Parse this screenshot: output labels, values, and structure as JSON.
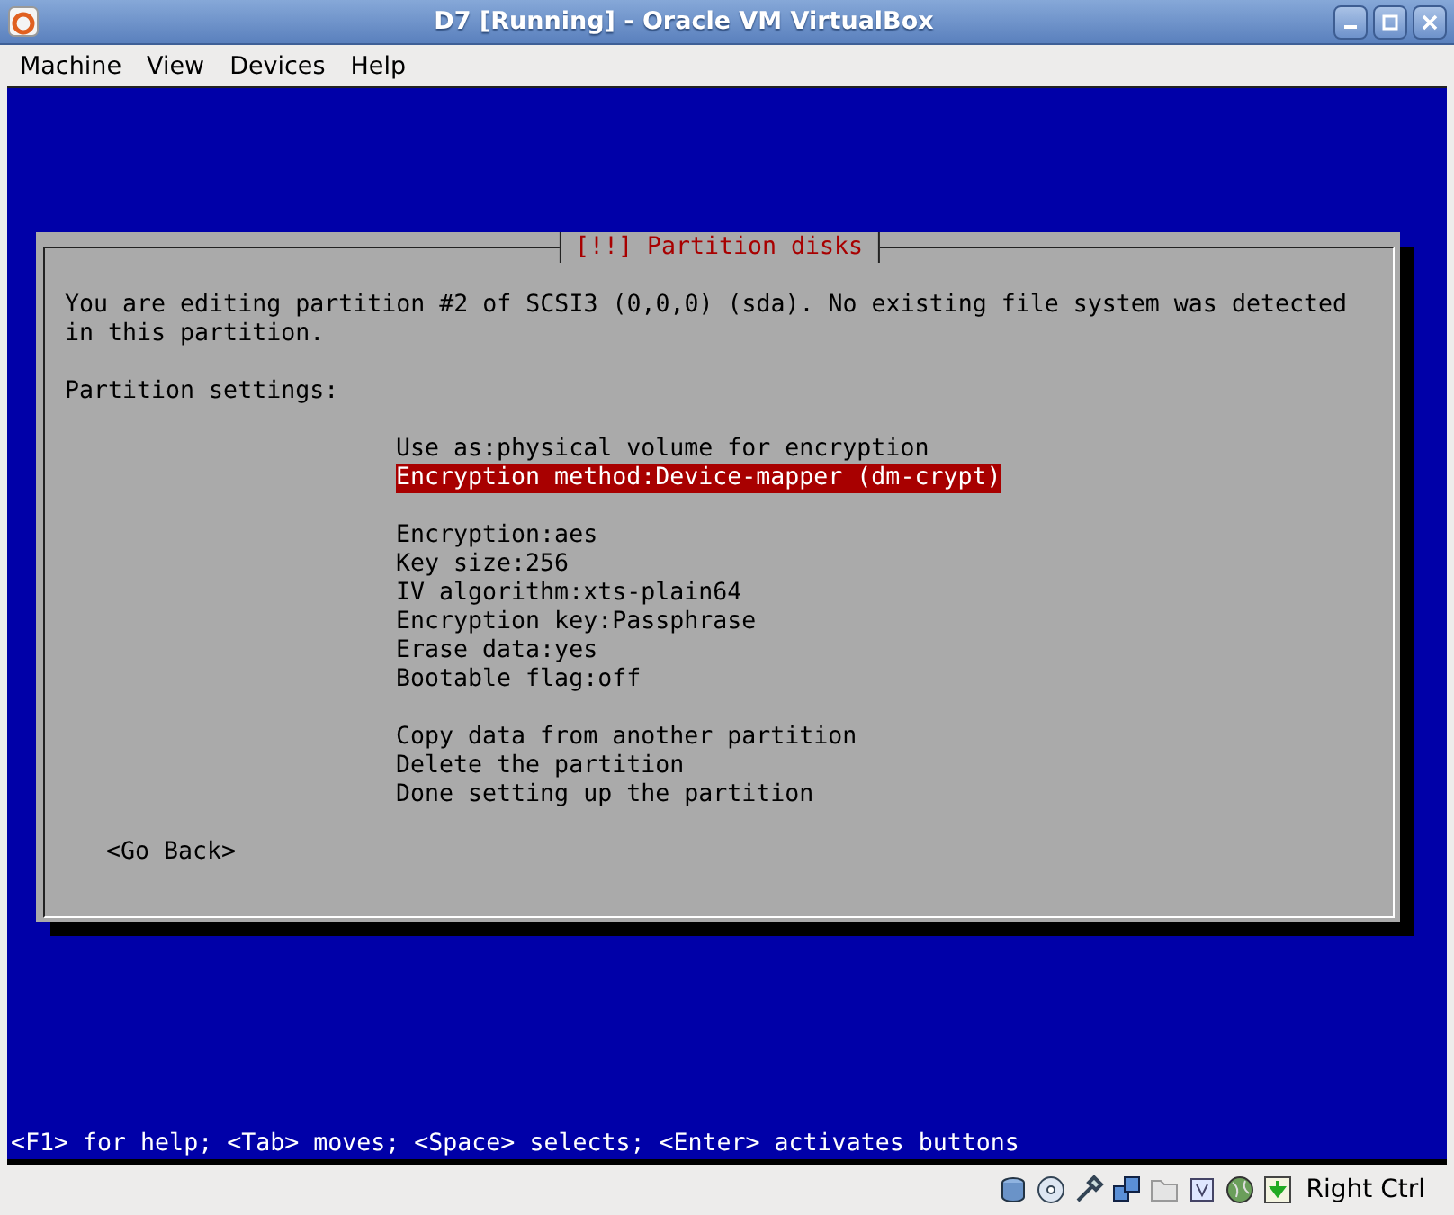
{
  "window": {
    "title": "D7 [Running] - Oracle VM VirtualBox"
  },
  "menu": [
    "Machine",
    "View",
    "Devices",
    "Help"
  ],
  "dialog": {
    "title": "[!!] Partition disks",
    "intro": "You are editing partition #2 of SCSI3 (0,0,0) (sda). No existing file system was detected in this partition.",
    "section": "Partition settings:",
    "groups": [
      [
        {
          "text": "Use as:physical volume for encryption",
          "selected": false
        },
        {
          "text": "Encryption method:Device-mapper (dm-crypt)",
          "selected": true
        }
      ],
      [
        {
          "text": "Encryption:aes",
          "selected": false
        },
        {
          "text": "Key size:256",
          "selected": false
        },
        {
          "text": "IV algorithm:xts-plain64",
          "selected": false
        },
        {
          "text": "Encryption key:Passphrase",
          "selected": false
        },
        {
          "text": "Erase data:yes",
          "selected": false
        },
        {
          "text": "Bootable flag:off",
          "selected": false
        }
      ],
      [
        {
          "text": "Copy data from another partition",
          "selected": false
        },
        {
          "text": "Delete the partition",
          "selected": false
        },
        {
          "text": "Done setting up the partition",
          "selected": false
        }
      ]
    ],
    "back_button": "<Go Back>"
  },
  "help_line": "<F1> for help; <Tab> moves; <Space> selects; <Enter> activates buttons",
  "status_bar": {
    "host_key": "Right Ctrl"
  }
}
